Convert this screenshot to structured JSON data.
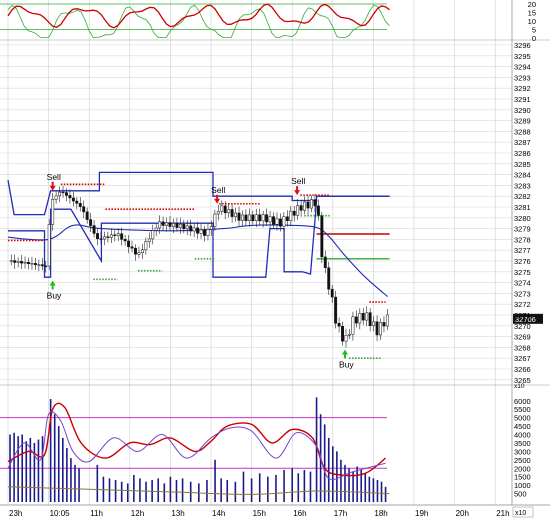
{
  "chart_data": {
    "type": "candlestick",
    "title": "",
    "panels": {
      "oscillator": {
        "y_ticks": [
          "20",
          "15",
          "10",
          "5",
          "0"
        ],
        "ylim": [
          0,
          20
        ],
        "reference_lines": [
          20,
          5
        ],
        "series": [
          {
            "color": "#cc0000"
          },
          {
            "color": "#33aa33"
          }
        ]
      },
      "price": {
        "ylim": [
          3264.5,
          3296.5
        ],
        "y_ticks": [
          "3296",
          "3295",
          "3294",
          "3293",
          "3292",
          "3291",
          "3290",
          "3289",
          "3288",
          "3287",
          "3286",
          "3285",
          "3284",
          "3283",
          "3282",
          "3281",
          "3280",
          "3279",
          "3278",
          "3277",
          "3276",
          "3275",
          "3274",
          "3273",
          "3272",
          "3271",
          "3270",
          "3269",
          "3268",
          "3267",
          "3266",
          "3265"
        ],
        "last_price": "3270.6",
        "horizontal_lines": [
          {
            "y": 3282,
            "color": "#1f2db5"
          },
          {
            "y": 3278.5,
            "color": "#cc0000"
          },
          {
            "y": 3276.2,
            "color": "#33aa33"
          }
        ],
        "signals": [
          {
            "label": "Buy",
            "type": "buy",
            "x": 1.1,
            "y": 3274.2
          },
          {
            "label": "Sell",
            "type": "sell",
            "x": 1.1,
            "y": 3282.5
          },
          {
            "label": "Sell",
            "type": "sell",
            "x": 5.15,
            "y": 3281.3
          },
          {
            "label": "Sell",
            "type": "sell",
            "x": 7.12,
            "y": 3282.1
          },
          {
            "label": "Buy",
            "type": "buy",
            "x": 8.3,
            "y": 3267.8
          }
        ],
        "close_path": [
          {
            "x": 0.0,
            "y": 3276.0
          },
          {
            "x": 0.5,
            "y": 3275.8
          },
          {
            "x": 0.95,
            "y": 3275.5
          },
          {
            "x": 1.05,
            "y": 3281.5
          },
          {
            "x": 1.3,
            "y": 3282.5
          },
          {
            "x": 1.8,
            "y": 3281.0
          },
          {
            "x": 2.2,
            "y": 3278.0
          },
          {
            "x": 2.7,
            "y": 3278.5
          },
          {
            "x": 3.2,
            "y": 3276.5
          },
          {
            "x": 3.7,
            "y": 3279.5
          },
          {
            "x": 4.3,
            "y": 3279.2
          },
          {
            "x": 4.9,
            "y": 3278.5
          },
          {
            "x": 5.2,
            "y": 3281.0
          },
          {
            "x": 5.7,
            "y": 3280.0
          },
          {
            "x": 6.3,
            "y": 3280.0
          },
          {
            "x": 6.7,
            "y": 3279.5
          },
          {
            "x": 7.2,
            "y": 3281.0
          },
          {
            "x": 7.6,
            "y": 3281.5
          },
          {
            "x": 7.75,
            "y": 3276.0
          },
          {
            "x": 7.95,
            "y": 3273.0
          },
          {
            "x": 8.1,
            "y": 3270.0
          },
          {
            "x": 8.3,
            "y": 3268.5
          },
          {
            "x": 8.5,
            "y": 3270.5
          },
          {
            "x": 8.8,
            "y": 3271.0
          },
          {
            "x": 9.1,
            "y": 3269.5
          },
          {
            "x": 9.3,
            "y": 3270.6
          }
        ],
        "channel_upper": [
          {
            "x": 0.0,
            "y": 3283.5
          },
          {
            "x": 0.15,
            "y": 3280.3
          },
          {
            "x": 0.9,
            "y": 3280.3
          },
          {
            "x": 1.05,
            "y": 3282.5
          },
          {
            "x": 2.25,
            "y": 3282.5
          },
          {
            "x": 2.25,
            "y": 3284.2
          },
          {
            "x": 5.05,
            "y": 3284.2
          },
          {
            "x": 5.05,
            "y": 3282.0
          },
          {
            "x": 7.0,
            "y": 3282.0
          },
          {
            "x": 7.0,
            "y": 3281.6
          },
          {
            "x": 7.6,
            "y": 3281.6
          },
          {
            "x": 7.6,
            "y": 3282.0
          },
          {
            "x": 9.4,
            "y": 3282.0
          }
        ],
        "channel_lower": [
          {
            "x": 0.0,
            "y": 3278.8
          },
          {
            "x": 0.9,
            "y": 3278.8
          },
          {
            "x": 0.9,
            "y": 3274.5
          },
          {
            "x": 1.05,
            "y": 3274.5
          },
          {
            "x": 1.05,
            "y": 3280.8
          },
          {
            "x": 1.55,
            "y": 3280.8
          },
          {
            "x": 2.3,
            "y": 3276.0
          },
          {
            "x": 2.3,
            "y": 3279.5
          },
          {
            "x": 5.05,
            "y": 3279.5
          },
          {
            "x": 5.05,
            "y": 3274.5
          },
          {
            "x": 6.35,
            "y": 3274.5
          },
          {
            "x": 6.45,
            "y": 3279.0
          },
          {
            "x": 6.8,
            "y": 3279.0
          },
          {
            "x": 6.8,
            "y": 3275.0
          },
          {
            "x": 7.25,
            "y": 3275.0
          },
          {
            "x": 7.45,
            "y": 3274.8
          },
          {
            "x": 7.6,
            "y": 3281.6
          }
        ],
        "ma_line": [
          {
            "x": 0.0,
            "y": 3278.2
          },
          {
            "x": 1.0,
            "y": 3278.0
          },
          {
            "x": 1.6,
            "y": 3279.3
          },
          {
            "x": 2.3,
            "y": 3279.0
          },
          {
            "x": 4.0,
            "y": 3278.8
          },
          {
            "x": 5.3,
            "y": 3279.0
          },
          {
            "x": 6.0,
            "y": 3279.3
          },
          {
            "x": 7.0,
            "y": 3279.3
          },
          {
            "x": 7.6,
            "y": 3279.1
          },
          {
            "x": 7.9,
            "y": 3278.3
          },
          {
            "x": 8.3,
            "y": 3276.5
          },
          {
            "x": 8.8,
            "y": 3274.5
          },
          {
            "x": 9.35,
            "y": 3272.7
          }
        ]
      },
      "volume": {
        "y_ticks": [
          "6000",
          "5500",
          "5000",
          "4500",
          "4000",
          "3500",
          "3000",
          "2500",
          "2000",
          "1500",
          "1000",
          "500"
        ],
        "ylim": [
          0,
          6400
        ],
        "scale_label": "x10",
        "reference_lines": [
          5000,
          2000
        ],
        "bars": [
          {
            "x": 0.05,
            "v": 4000
          },
          {
            "x": 0.15,
            "v": 4100
          },
          {
            "x": 0.25,
            "v": 3900
          },
          {
            "x": 0.35,
            "v": 4000
          },
          {
            "x": 0.45,
            "v": 3600
          },
          {
            "x": 0.55,
            "v": 3800
          },
          {
            "x": 0.65,
            "v": 3500
          },
          {
            "x": 0.75,
            "v": 3700
          },
          {
            "x": 0.85,
            "v": 3900
          },
          {
            "x": 1.05,
            "v": 6100
          },
          {
            "x": 1.15,
            "v": 5200
          },
          {
            "x": 1.25,
            "v": 4500
          },
          {
            "x": 1.35,
            "v": 3800
          },
          {
            "x": 1.45,
            "v": 3200
          },
          {
            "x": 1.55,
            "v": 2600
          },
          {
            "x": 1.65,
            "v": 2200
          },
          {
            "x": 1.75,
            "v": 2000
          },
          {
            "x": 2.2,
            "v": 2200
          },
          {
            "x": 2.35,
            "v": 1500
          },
          {
            "x": 2.5,
            "v": 1400
          },
          {
            "x": 2.65,
            "v": 1300
          },
          {
            "x": 2.8,
            "v": 1200
          },
          {
            "x": 2.95,
            "v": 1100
          },
          {
            "x": 3.1,
            "v": 1600
          },
          {
            "x": 3.25,
            "v": 1400
          },
          {
            "x": 3.4,
            "v": 1200
          },
          {
            "x": 3.55,
            "v": 1300
          },
          {
            "x": 3.7,
            "v": 1400
          },
          {
            "x": 3.85,
            "v": 1100
          },
          {
            "x": 4.0,
            "v": 1500
          },
          {
            "x": 4.15,
            "v": 1300
          },
          {
            "x": 4.3,
            "v": 1400
          },
          {
            "x": 4.5,
            "v": 1200
          },
          {
            "x": 4.7,
            "v": 1100
          },
          {
            "x": 4.9,
            "v": 1300
          },
          {
            "x": 5.1,
            "v": 2500
          },
          {
            "x": 5.25,
            "v": 1400
          },
          {
            "x": 5.4,
            "v": 1300
          },
          {
            "x": 5.6,
            "v": 1200
          },
          {
            "x": 5.8,
            "v": 1800
          },
          {
            "x": 6.0,
            "v": 1400
          },
          {
            "x": 6.2,
            "v": 1700
          },
          {
            "x": 6.4,
            "v": 1500
          },
          {
            "x": 6.6,
            "v": 1600
          },
          {
            "x": 6.8,
            "v": 1900
          },
          {
            "x": 7.0,
            "v": 2000
          },
          {
            "x": 7.15,
            "v": 1700
          },
          {
            "x": 7.3,
            "v": 1900
          },
          {
            "x": 7.45,
            "v": 1800
          },
          {
            "x": 7.6,
            "v": 6200
          },
          {
            "x": 7.7,
            "v": 5200
          },
          {
            "x": 7.8,
            "v": 4600
          },
          {
            "x": 7.9,
            "v": 3800
          },
          {
            "x": 8.0,
            "v": 3300
          },
          {
            "x": 8.1,
            "v": 3000
          },
          {
            "x": 8.2,
            "v": 2500
          },
          {
            "x": 8.3,
            "v": 2200
          },
          {
            "x": 8.4,
            "v": 2000
          },
          {
            "x": 8.5,
            "v": 1800
          },
          {
            "x": 8.6,
            "v": 2100
          },
          {
            "x": 8.7,
            "v": 1900
          },
          {
            "x": 8.8,
            "v": 1700
          },
          {
            "x": 8.9,
            "v": 1500
          },
          {
            "x": 9.0,
            "v": 1400
          },
          {
            "x": 9.1,
            "v": 1300
          },
          {
            "x": 9.2,
            "v": 1200
          },
          {
            "x": 9.3,
            "v": 900
          }
        ],
        "lines": [
          {
            "color": "#cc0000",
            "points": [
              {
                "x": 0.0,
                "v": 2400
              },
              {
                "x": 0.5,
                "v": 3000
              },
              {
                "x": 0.9,
                "v": 2800
              },
              {
                "x": 1.1,
                "v": 5500
              },
              {
                "x": 1.4,
                "v": 5600
              },
              {
                "x": 1.8,
                "v": 3500
              },
              {
                "x": 2.4,
                "v": 2600
              },
              {
                "x": 3.0,
                "v": 3500
              },
              {
                "x": 3.5,
                "v": 3400
              },
              {
                "x": 4.0,
                "v": 3800
              },
              {
                "x": 4.6,
                "v": 3000
              },
              {
                "x": 5.0,
                "v": 3600
              },
              {
                "x": 5.4,
                "v": 4500
              },
              {
                "x": 6.0,
                "v": 4600
              },
              {
                "x": 6.5,
                "v": 3500
              },
              {
                "x": 7.0,
                "v": 4300
              },
              {
                "x": 7.5,
                "v": 3800
              },
              {
                "x": 7.8,
                "v": 2000
              },
              {
                "x": 8.2,
                "v": 1600
              },
              {
                "x": 8.8,
                "v": 1700
              },
              {
                "x": 9.3,
                "v": 2600
              }
            ]
          },
          {
            "color": "#7744cc",
            "points": [
              {
                "x": 0.0,
                "v": 2000
              },
              {
                "x": 0.4,
                "v": 3500
              },
              {
                "x": 0.8,
                "v": 2500
              },
              {
                "x": 1.0,
                "v": 5200
              },
              {
                "x": 1.3,
                "v": 4800
              },
              {
                "x": 1.6,
                "v": 3000
              },
              {
                "x": 2.0,
                "v": 2400
              },
              {
                "x": 2.6,
                "v": 3800
              },
              {
                "x": 3.2,
                "v": 3000
              },
              {
                "x": 3.8,
                "v": 4000
              },
              {
                "x": 4.4,
                "v": 2600
              },
              {
                "x": 5.0,
                "v": 3800
              },
              {
                "x": 5.5,
                "v": 4400
              },
              {
                "x": 6.0,
                "v": 4200
              },
              {
                "x": 6.6,
                "v": 2600
              },
              {
                "x": 7.1,
                "v": 4100
              },
              {
                "x": 7.6,
                "v": 3300
              },
              {
                "x": 7.9,
                "v": 1400
              },
              {
                "x": 8.5,
                "v": 1800
              },
              {
                "x": 9.3,
                "v": 2300
              }
            ]
          },
          {
            "color": "#8a7a2a",
            "points": [
              {
                "x": 0.0,
                "v": 900
              },
              {
                "x": 2.0,
                "v": 750
              },
              {
                "x": 4.0,
                "v": 600
              },
              {
                "x": 6.0,
                "v": 450
              },
              {
                "x": 7.6,
                "v": 650
              },
              {
                "x": 9.4,
                "v": 500
              }
            ]
          }
        ]
      }
    },
    "x_ticks": [
      {
        "x": 0,
        "label": "23h"
      },
      {
        "x": 1,
        "label": "10:05"
      },
      {
        "x": 2,
        "label": "11h"
      },
      {
        "x": 3,
        "label": "12h"
      },
      {
        "x": 4,
        "label": "13h"
      },
      {
        "x": 5,
        "label": "14h"
      },
      {
        "x": 6,
        "label": "15h"
      },
      {
        "x": 7,
        "label": "16h"
      },
      {
        "x": 8,
        "label": "17h"
      },
      {
        "x": 9,
        "label": "18h"
      },
      {
        "x": 10,
        "label": "19h"
      },
      {
        "x": 11,
        "label": "20h"
      },
      {
        "x": 12,
        "label": "21h"
      }
    ],
    "corner_label": "x10"
  }
}
